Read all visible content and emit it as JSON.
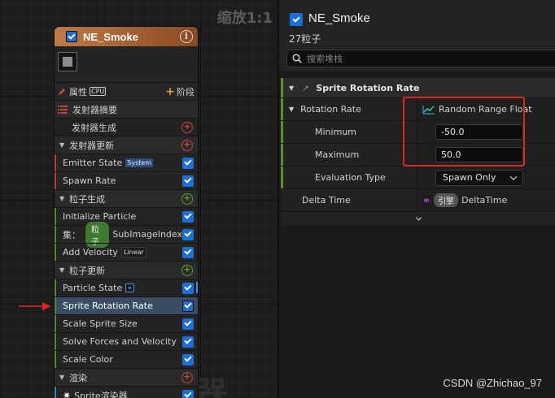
{
  "graph": {
    "zoom_label": "缩放1:1",
    "watermark": "发射器"
  },
  "node": {
    "title": "NE_Smoke",
    "info_icon": "info-icon",
    "toolbar": {
      "properties_label": "属性",
      "cpu_badge": "CPU",
      "stage_label": "阶段"
    },
    "rows": {
      "summary": "发射器摘要",
      "emitter_spawn": "发射器生成",
      "emitter_update": "发射器更新",
      "emitter_state": "Emitter State",
      "emitter_state_tag": "System",
      "spawn_rate": "Spawn Rate",
      "particle_spawn": "粒子生成",
      "initialize_particle": "Initialize Particle",
      "set_label": "集：",
      "set_pill": "粒子",
      "sub_image_index": "SubImageIndex",
      "add_velocity": "Add Velocity",
      "add_velocity_tag": "Linear",
      "particle_update": "粒子更新",
      "particle_state": "Particle State",
      "sprite_rotation_rate": "Sprite Rotation Rate",
      "scale_sprite_size": "Scale Sprite Size",
      "solve_forces": "Solve Forces and Velocity",
      "scale_color": "Scale Color",
      "render": "渲染",
      "sprite_renderer": "Sprite渲染器"
    }
  },
  "panel": {
    "title": "NE_Smoke",
    "subtitle": "27粒子",
    "search_placeholder": "搜索堆栈",
    "category": "Sprite Rotation Rate",
    "props": {
      "rotation_rate": "Rotation Rate",
      "rotation_rate_value": "Random Range Float",
      "minimum": "Minimum",
      "minimum_value": "-50.0",
      "maximum": "Maximum",
      "maximum_value": "50.0",
      "evaluation_type": "Evaluation Type",
      "evaluation_value": "Spawn Only",
      "delta_time": "Delta Time",
      "engine_tag": "引擎",
      "delta_time_value": "DeltaTime"
    }
  },
  "credit": "CSDN @Zhichao_97",
  "colors": {
    "node_header": "#c07a45",
    "checkbox": "#1d6fd8",
    "selected_row": "#3b4d64",
    "highlight_box": "#e0261e",
    "arrow": "#e0261e"
  }
}
